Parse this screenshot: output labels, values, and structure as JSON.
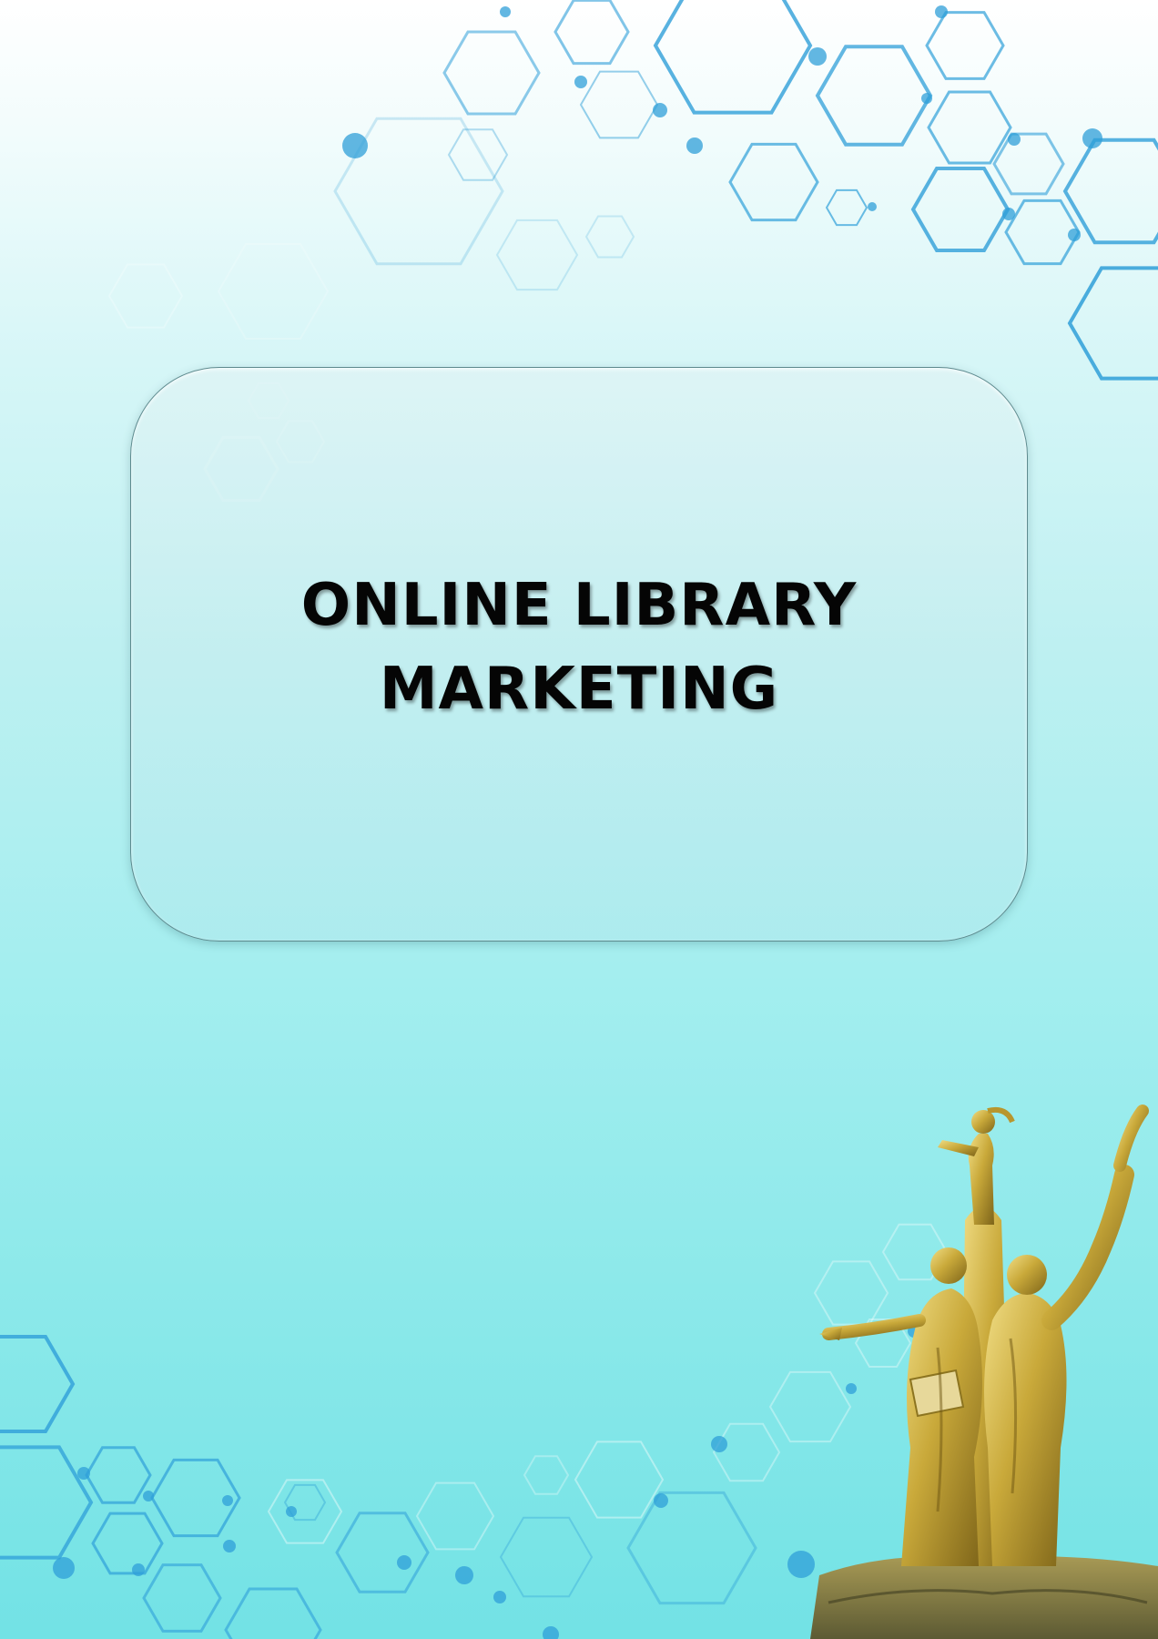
{
  "document": {
    "title_line1": "ONLINE LIBRARY",
    "title_line2": "MARKETING"
  },
  "colors": {
    "background_top": "#ffffff",
    "background_bottom": "#72e2e5",
    "hexagon_accent": "#2f9fd8",
    "title_text": "#050505",
    "statue_gold": "#c9a93a"
  },
  "icons": {
    "decoration": "hexagon-network-pattern",
    "illustration": "golden-statue-monument"
  }
}
